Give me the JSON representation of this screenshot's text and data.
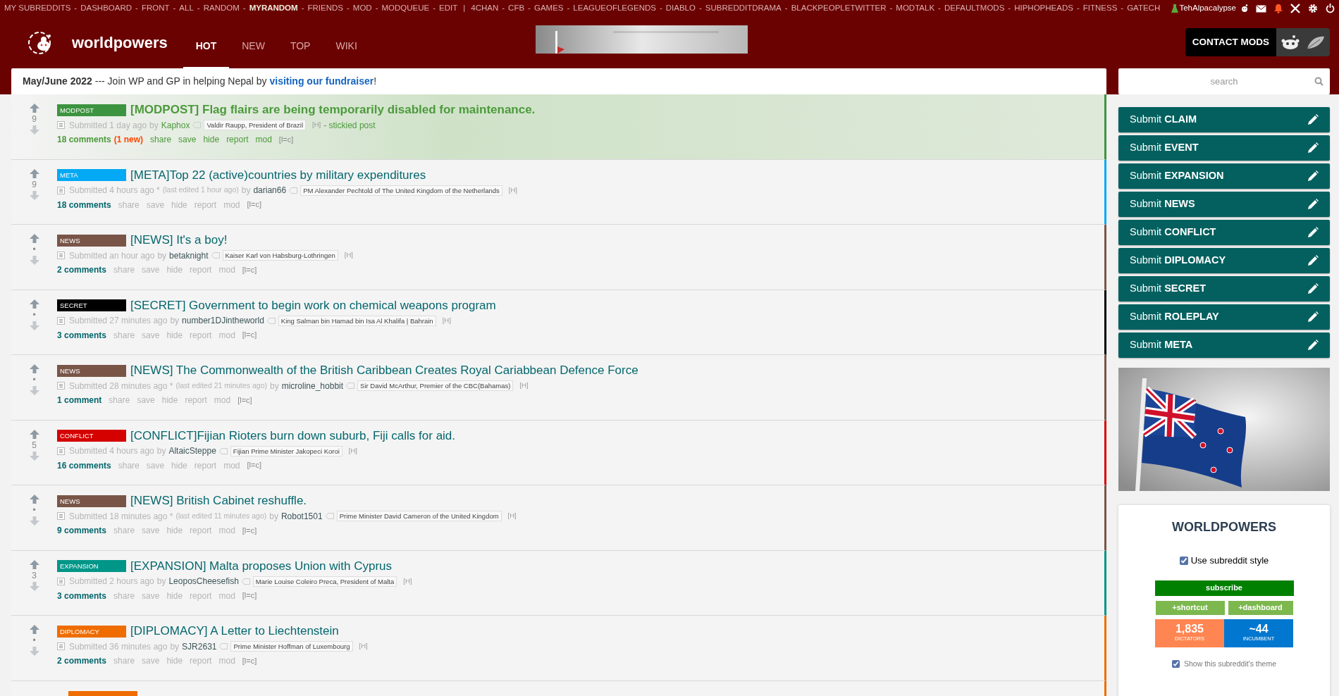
{
  "top_bar": {
    "groups": [
      {
        "links": [
          {
            "label": "MY SUBREDDITS",
            "bold": false
          },
          {
            "label": "DASHBOARD",
            "bold": false
          },
          {
            "label": "FRONT",
            "bold": false
          },
          {
            "label": "ALL",
            "bold": false
          },
          {
            "label": "RANDOM",
            "bold": false
          },
          {
            "label": "MYRANDOM",
            "bold": true
          },
          {
            "label": "FRIENDS",
            "bold": false
          },
          {
            "label": "MOD",
            "bold": false
          },
          {
            "label": "MODQUEUE",
            "bold": false
          },
          {
            "label": "EDIT",
            "bold": false
          }
        ]
      },
      {
        "links": [
          {
            "label": "4CHAN",
            "bold": false
          },
          {
            "label": "CFB",
            "bold": false
          },
          {
            "label": "GAMES",
            "bold": false
          },
          {
            "label": "LEAGUEOFLEGENDS",
            "bold": false
          },
          {
            "label": "DIABLO",
            "bold": false
          },
          {
            "label": "SUBREDDITDRAMA",
            "bold": false
          },
          {
            "label": "BLACKPEOPLETWITTER",
            "bold": false
          },
          {
            "label": "MODTALK",
            "bold": false
          },
          {
            "label": "DEFAULTMODS",
            "bold": false
          },
          {
            "label": "HIPHOPHEADS",
            "bold": false
          },
          {
            "label": "FITNESS",
            "bold": false
          },
          {
            "label": "GATECH",
            "bold": false
          }
        ]
      }
    ],
    "separator": "-",
    "group_separator": "|",
    "user": "TehAlpacalypse"
  },
  "header": {
    "subreddit": "worldpowers",
    "tabs": [
      {
        "label": "HOT",
        "selected": true
      },
      {
        "label": "NEW",
        "selected": false
      },
      {
        "label": "TOP",
        "selected": false
      },
      {
        "label": "WIKI",
        "selected": false
      }
    ],
    "contact_button": "CONTACT MODS"
  },
  "announcement": "**May/June 2022** --- Join WP and GP in helping Nepal by ",
  "announcement_link": "visiting our fundraiser",
  "announcement_end": "!",
  "posts": [
    {
      "kind": "full",
      "stickied": true,
      "flair": {
        "label": "MODPOST",
        "color": "#3d9440"
      },
      "title": "[MODPOST] Flag flairs are being temporarily disabled for maintenance.",
      "score": "9",
      "submitted": "Submitted 1 day ago",
      "by": "by",
      "author": "Kaphox",
      "user_flair": "Valdir Raupp, President of Brazil",
      "h": "[H]",
      "sticky_note": "- stickied post",
      "comments": "18 comments",
      "new_comments": "(1 new)",
      "actions": [
        "share",
        "save",
        "hide",
        "report",
        "mod",
        "[l=c]"
      ]
    },
    {
      "kind": "full",
      "stickied": false,
      "flair": {
        "label": "META",
        "color": "#03a9f4"
      },
      "title": "[META]Top 22 (active)countries by military expenditures",
      "score": "9",
      "submitted": "Submitted 4 hours ago *",
      "edited": "(last edited 1 hour ago)",
      "by": "by",
      "author": "darian66",
      "user_flair": "PM Alexander Pechtold of The United Kingdom of the Netherlands",
      "h": "[H]",
      "comments": "18 comments",
      "actions": [
        "share",
        "save",
        "hide",
        "report",
        "mod",
        "[l=c]"
      ]
    },
    {
      "kind": "full",
      "stickied": false,
      "flair": {
        "label": "NEWS",
        "color": "#795548"
      },
      "title": "[NEWS] It's a boy!",
      "score": "•",
      "submitted": "Submitted an hour ago",
      "by": "by",
      "author": "betaknight",
      "user_flair": "Kaiser Karl von Habsburg-Lothringen",
      "h": "[H]",
      "comments": "2 comments",
      "actions": [
        "share",
        "save",
        "hide",
        "report",
        "mod",
        "[l=c]"
      ]
    },
    {
      "kind": "full",
      "stickied": false,
      "flair": {
        "label": "SECRET",
        "color": "#000000"
      },
      "title": "[SECRET] Government to begin work on chemical weapons program",
      "score": "•",
      "submitted": "Submitted 27 minutes ago",
      "by": "by",
      "author": "number1DJintheworld",
      "user_flair": "King Salman bin Hamad bin Isa Al Khalifa | Bahrain",
      "h": "[H]",
      "comments": "3 comments",
      "actions": [
        "share",
        "save",
        "hide",
        "report",
        "mod",
        "[l=c]"
      ]
    },
    {
      "kind": "full",
      "stickied": false,
      "flair": {
        "label": "NEWS",
        "color": "#795548"
      },
      "title": "[NEWS] The Commonwealth of the British Caribbean Creates Royal Cariabbean Defence Force",
      "score": "•",
      "submitted": "Submitted 28 minutes ago *",
      "edited": "(last edited 21 minutes ago)",
      "by": "by",
      "author": "microline_hobbit",
      "user_flair": "Sir David McArthur, Premier of the CBC(Bahamas)",
      "h": "[H]",
      "comments": "1 comment",
      "actions": [
        "share",
        "save",
        "hide",
        "report",
        "mod",
        "[l=c]"
      ]
    },
    {
      "kind": "full",
      "stickied": false,
      "flair": {
        "label": "CONFLICT",
        "color": "#d50000"
      },
      "title": "[CONFLICT]Fijian Rioters burn down suburb, Fiji calls for aid.",
      "score": "5",
      "submitted": "Submitted 4 hours ago",
      "by": "by",
      "author": "AltaicSteppe",
      "user_flair": "Fijian Prime Minister Jakopeci Koroi",
      "h": "[H]",
      "comments": "16 comments",
      "actions": [
        "share",
        "save",
        "hide",
        "report",
        "mod",
        "[l=c]"
      ]
    },
    {
      "kind": "full",
      "stickied": false,
      "flair": {
        "label": "NEWS",
        "color": "#795548"
      },
      "title": "[NEWS] British Cabinet reshuffle.",
      "score": "•",
      "submitted": "Submitted 18 minutes ago *",
      "edited": "(last edited 11 minutes ago)",
      "by": "by",
      "author": "Robot1501",
      "user_flair": "Prime Minister David Cameron of the United Kingdom",
      "h": "[H]",
      "comments": "9 comments",
      "actions": [
        "share",
        "save",
        "hide",
        "report",
        "mod",
        "[l=c]"
      ]
    },
    {
      "kind": "full",
      "stickied": false,
      "flair": {
        "label": "EXPANSION",
        "color": "#009688"
      },
      "title": "[EXPANSION] Malta proposes Union with Cyprus",
      "score": "3",
      "submitted": "Submitted 2 hours ago",
      "by": "by",
      "author": "LeoposCheesefish",
      "user_flair": "Marie Louise Coleiro Preca, President of Malta",
      "h": "[H]",
      "comments": "3 comments",
      "actions": [
        "share",
        "save",
        "hide",
        "report",
        "mod",
        "[l=c]"
      ]
    },
    {
      "kind": "full",
      "stickied": false,
      "flair": {
        "label": "DIPLOMACY",
        "color": "#ef6c00"
      },
      "title": "[DIPLOMACY] A Letter to Liechtenstein",
      "score": "•",
      "submitted": "Submitted 36 minutes ago",
      "by": "by",
      "author": "SJR2631",
      "user_flair": "Prime Minister Hoffman of Luxembourg",
      "h": "[H]",
      "comments": "2 comments",
      "actions": [
        "share",
        "save",
        "hide",
        "report",
        "mod",
        "[l=c]"
      ]
    },
    {
      "kind": "partial",
      "flair": {
        "color": "#ef6c00"
      }
    }
  ],
  "sidebar": {
    "search": {
      "placeholder": "search"
    },
    "submit_buttons": [
      "Submit **CLAIM**",
      "Submit **EVENT**",
      "Submit **EXPANSION**",
      "Submit **NEWS**",
      "Submit **CONFLICT**",
      "Submit **DIPLOMACY**",
      "Submit **SECRET**",
      "Submit **ROLEPLAY**",
      "Submit **META**"
    ],
    "card": {
      "title": "WORLDPOWERS",
      "style_checkbox": {
        "label": "Use subreddit style",
        "checked": true
      },
      "subscribe": "subscribe",
      "shortcut": "+shortcut",
      "dashboard": "+dashboard",
      "stats": [
        {
          "value": "1,835",
          "label": "DICTATORS",
          "color": "#ff8552"
        },
        {
          "value": "~44",
          "label": "INCUMBENT",
          "color": "#0277d0"
        }
      ],
      "theme_checkbox": {
        "label": "Show this subreddit's theme",
        "checked": true
      }
    }
  }
}
